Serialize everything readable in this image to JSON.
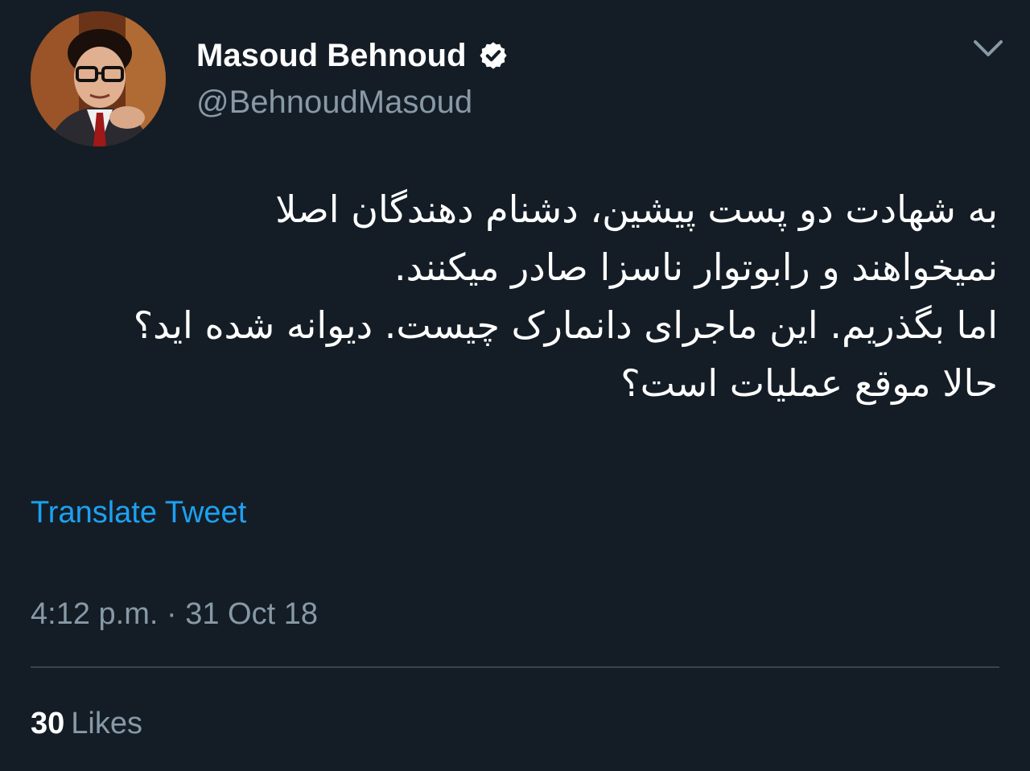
{
  "user": {
    "display_name": "Masoud Behnoud",
    "handle": "@BehnoudMasoud",
    "verified_icon": "verified-badge-icon",
    "avatar_icon": "profile-photo"
  },
  "menu_icon": "chevron-down-icon",
  "tweet": {
    "lines": [
      "به شهادت دو پست پیشین، دشنام دهندگان اصلا",
      "نمیخواهند و رابوتوار ناسزا صادر میکنند.",
      "اما بگذریم. این ماجرای دانمارک چیست. دیوانه شده اید؟",
      "حالا موقع عملیات است؟"
    ]
  },
  "translate_label": "Translate Tweet",
  "timestamp": "4:12 p.m. · 31 Oct 18",
  "likes": {
    "count": "30",
    "label": "Likes"
  },
  "colors": {
    "background": "#141d26",
    "accent": "#1da1f2",
    "secondary_text": "#8899a6",
    "divider": "#38444d"
  }
}
